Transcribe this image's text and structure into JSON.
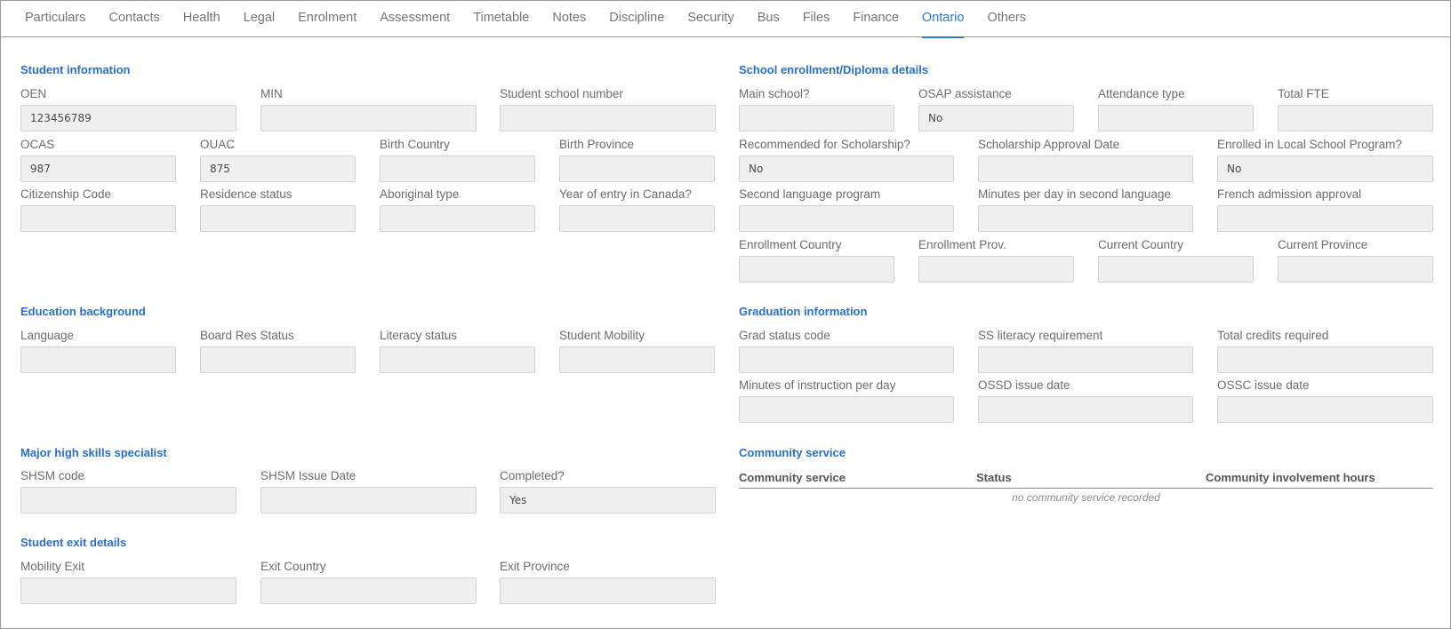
{
  "tabs": [
    {
      "label": "Particulars",
      "active": false
    },
    {
      "label": "Contacts",
      "active": false
    },
    {
      "label": "Health",
      "active": false
    },
    {
      "label": "Legal",
      "active": false
    },
    {
      "label": "Enrolment",
      "active": false
    },
    {
      "label": "Assessment",
      "active": false
    },
    {
      "label": "Timetable",
      "active": false
    },
    {
      "label": "Notes",
      "active": false
    },
    {
      "label": "Discipline",
      "active": false
    },
    {
      "label": "Security",
      "active": false
    },
    {
      "label": "Bus",
      "active": false
    },
    {
      "label": "Files",
      "active": false
    },
    {
      "label": "Finance",
      "active": false
    },
    {
      "label": "Ontario",
      "active": true
    },
    {
      "label": "Others",
      "active": false
    }
  ],
  "student_info": {
    "title": "Student information",
    "oen": {
      "label": "OEN",
      "value": "123456789"
    },
    "min": {
      "label": "MIN",
      "value": ""
    },
    "school_number": {
      "label": "Student school number",
      "value": ""
    },
    "ocas": {
      "label": "OCAS",
      "value": "987"
    },
    "ouac": {
      "label": "OUAC",
      "value": "875"
    },
    "birth_country": {
      "label": "Birth Country",
      "value": ""
    },
    "birth_province": {
      "label": "Birth Province",
      "value": ""
    },
    "citizenship": {
      "label": "Citizenship Code",
      "value": ""
    },
    "residence": {
      "label": "Residence status",
      "value": ""
    },
    "aboriginal": {
      "label": "Aboriginal type",
      "value": ""
    },
    "year_entry": {
      "label": "Year of entry in Canada?",
      "value": ""
    }
  },
  "education": {
    "title": "Education background",
    "language": {
      "label": "Language",
      "value": ""
    },
    "board_res": {
      "label": "Board Res Status",
      "value": ""
    },
    "literacy": {
      "label": "Literacy status",
      "value": ""
    },
    "mobility": {
      "label": "Student Mobility",
      "value": ""
    }
  },
  "shsm": {
    "title": "Major high skills specialist",
    "code": {
      "label": "SHSM code",
      "value": ""
    },
    "issue_date": {
      "label": "SHSM Issue Date",
      "value": ""
    },
    "completed": {
      "label": "Completed?",
      "value": "Yes"
    }
  },
  "exit": {
    "title": "Student exit details",
    "mobility_exit": {
      "label": "Mobility Exit",
      "value": ""
    },
    "exit_country": {
      "label": "Exit Country",
      "value": ""
    },
    "exit_province": {
      "label": "Exit Province",
      "value": ""
    }
  },
  "enrollment": {
    "title": "School enrollment/Diploma details",
    "main_school": {
      "label": "Main school?",
      "value": ""
    },
    "osap": {
      "label": "OSAP assistance",
      "value": "No"
    },
    "attendance": {
      "label": "Attendance type",
      "value": ""
    },
    "total_fte": {
      "label": "Total FTE",
      "value": ""
    },
    "scholarship_rec": {
      "label": "Recommended for Scholarship?",
      "value": "No"
    },
    "scholarship_date": {
      "label": "Scholarship Approval Date",
      "value": ""
    },
    "local_program": {
      "label": "Enrolled in Local School Program?",
      "value": "No"
    },
    "second_lang": {
      "label": "Second language program",
      "value": ""
    },
    "minutes_second": {
      "label": "Minutes per day in second language",
      "value": ""
    },
    "french_admission": {
      "label": "French admission approval",
      "value": ""
    },
    "enroll_country": {
      "label": "Enrollment Country",
      "value": ""
    },
    "enroll_prov": {
      "label": "Enrollment Prov.",
      "value": ""
    },
    "current_country": {
      "label": "Current Country",
      "value": ""
    },
    "current_province": {
      "label": "Current Province",
      "value": ""
    }
  },
  "graduation": {
    "title": "Graduation information",
    "grad_status": {
      "label": "Grad status code",
      "value": ""
    },
    "ss_literacy": {
      "label": "SS literacy requirement",
      "value": ""
    },
    "total_credits": {
      "label": "Total credits required",
      "value": ""
    },
    "minutes_instruction": {
      "label": "Minutes of instruction per day",
      "value": ""
    },
    "ossd_date": {
      "label": "OSSD issue date",
      "value": ""
    },
    "ossc_date": {
      "label": "OSSC issue date",
      "value": ""
    }
  },
  "community": {
    "title": "Community service",
    "columns": [
      "Community service",
      "Status",
      "Community involvement hours"
    ],
    "empty_message": "no community service recorded"
  }
}
